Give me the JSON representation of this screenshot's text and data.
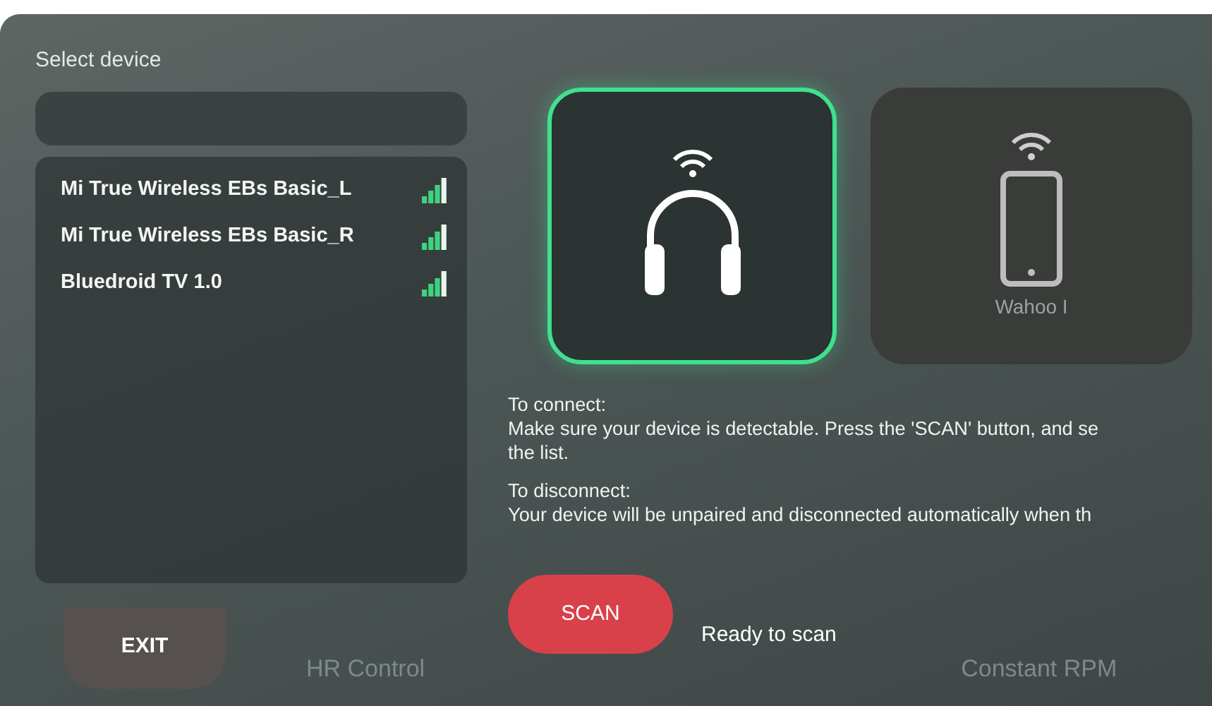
{
  "background_modes": [
    "HR Control",
    "Constant RPM"
  ],
  "panel": {
    "title": "Select device",
    "devices": [
      {
        "name": "Mi True Wireless EBs Basic_L"
      },
      {
        "name": "Mi True Wireless EBs Basic_R"
      },
      {
        "name": "Bluedroid TV 1.0"
      }
    ],
    "exit_button": "EXIT"
  },
  "device_types": [
    {
      "kind": "headphones",
      "selected": true
    },
    {
      "kind": "phone",
      "selected": false,
      "label": "Wahoo I"
    }
  ],
  "help": [
    {
      "heading": "To connect:",
      "lines": [
        "Make sure your device is detectable. Press the 'SCAN' button, and se",
        "the list."
      ]
    },
    {
      "heading": "To disconnect:",
      "lines": [
        "Your device will be unpaired and disconnected automatically when th"
      ]
    }
  ],
  "scan_button": "SCAN",
  "status": "Ready to scan"
}
